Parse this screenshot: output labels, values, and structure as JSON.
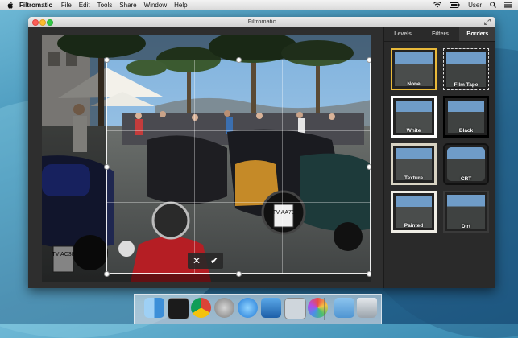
{
  "menubar": {
    "app_name": "Filtromatic",
    "menus": [
      "File",
      "Edit",
      "Tools",
      "Share",
      "Window",
      "Help"
    ],
    "user": "User"
  },
  "window": {
    "title": "Filtromatic"
  },
  "sidebar": {
    "tabs": [
      {
        "label": "Levels",
        "active": false
      },
      {
        "label": "Filters",
        "active": false
      },
      {
        "label": "Borders",
        "active": true
      }
    ],
    "borders": [
      {
        "label": "None",
        "selected": true
      },
      {
        "label": "Film Tape",
        "selected": false
      },
      {
        "label": "White",
        "selected": false
      },
      {
        "label": "Black",
        "selected": false
      },
      {
        "label": "Texture",
        "selected": false
      },
      {
        "label": "CRT",
        "selected": false
      },
      {
        "label": "Painted",
        "selected": false
      },
      {
        "label": "Dirt",
        "selected": false
      }
    ]
  },
  "crop": {
    "cancel_icon": "✕",
    "confirm_icon": "✔"
  },
  "photo": {
    "plate_left": "TV AC38",
    "plate_right": "TV AA73"
  },
  "dock": {
    "items": [
      "finder-icon",
      "terminal-icon",
      "chrome-icon",
      "launchpad-icon",
      "itunes-icon",
      "xcode-icon",
      "preview-icon",
      "filtromatic-icon",
      "folder-icon",
      "trash-icon"
    ]
  },
  "colors": {
    "accent_selected": "#e8b93a",
    "window_bg": "#2f2f2f",
    "sidebar_bg": "#2a2a2a"
  }
}
